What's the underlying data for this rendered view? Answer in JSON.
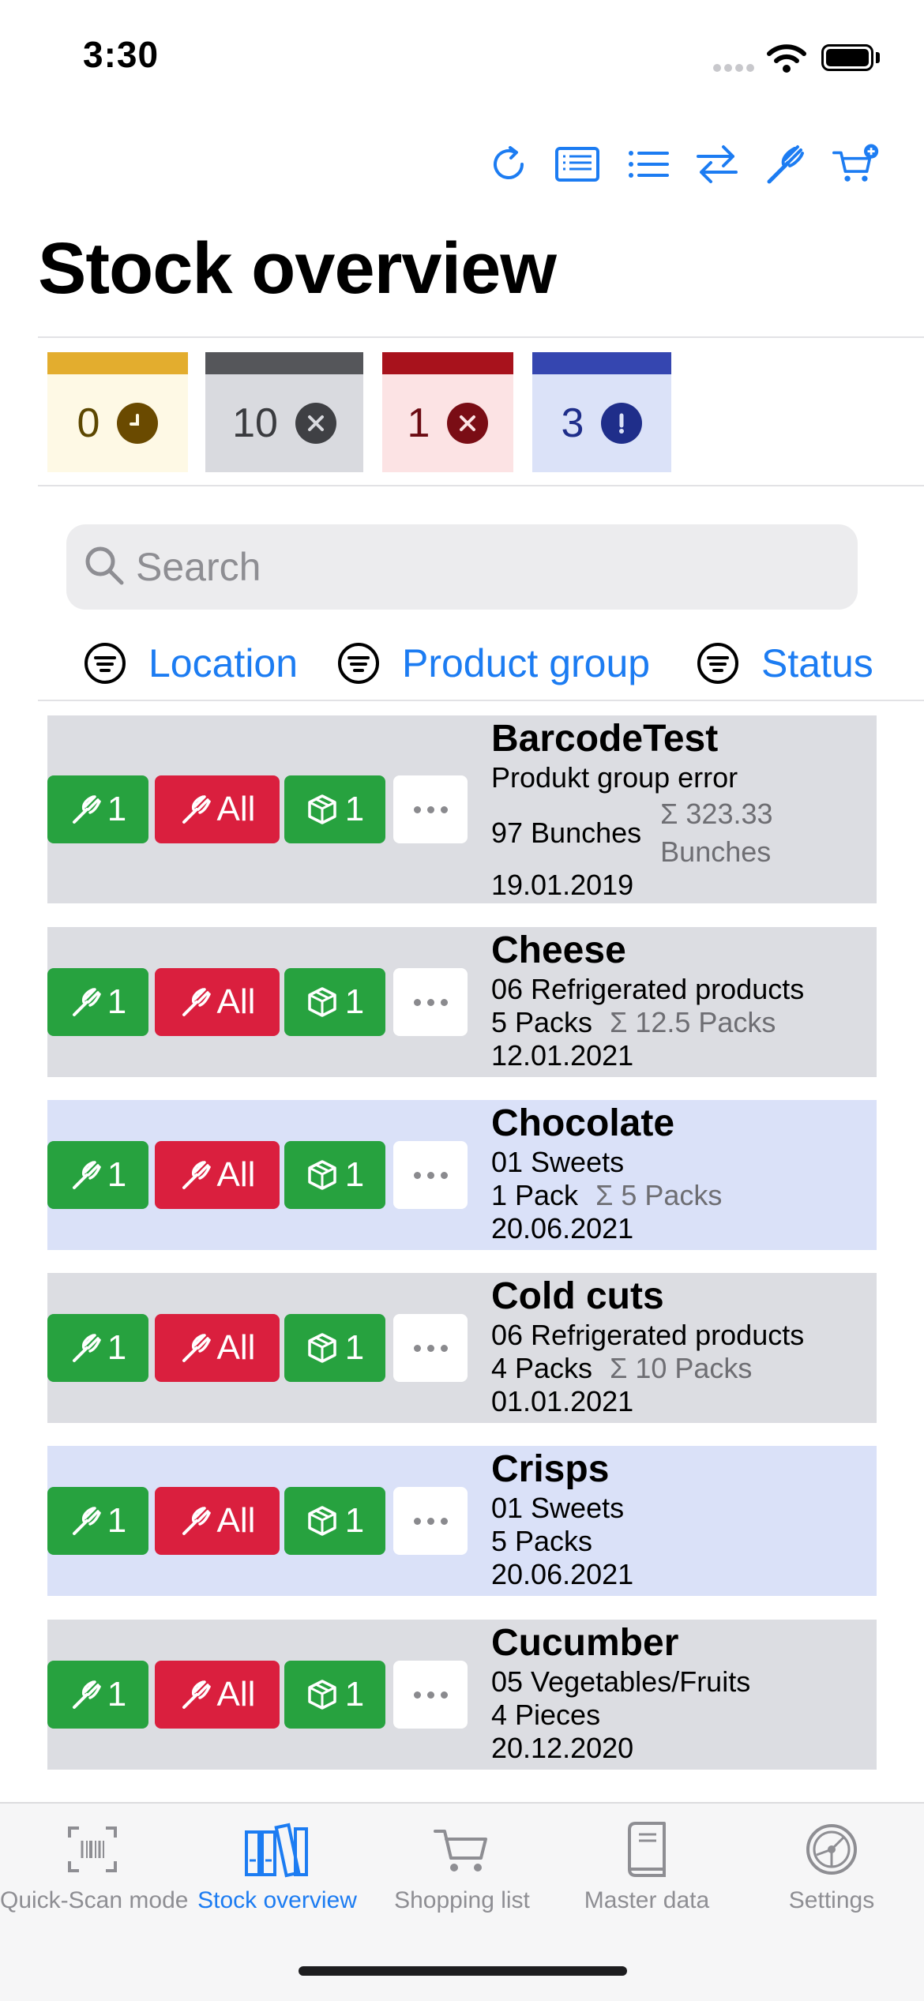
{
  "status_bar": {
    "time": "3:30"
  },
  "toolbar": {
    "icons": [
      "refresh-icon",
      "journal-icon",
      "list-icon",
      "transfer-icon",
      "consume-icon",
      "purchase-icon"
    ]
  },
  "page": {
    "title": "Stock overview"
  },
  "status_tiles": [
    {
      "count": "0",
      "kind": "due-soon",
      "bar": "#e3ad2e",
      "bg": "#fef9e5",
      "text": "#5c4700",
      "icon_bg": "#6a4a00"
    },
    {
      "count": "10",
      "kind": "overdue",
      "bar": "#55565a",
      "bg": "#d9dadf",
      "text": "#3a3b3f",
      "icon_bg": "#3f4044"
    },
    {
      "count": "1",
      "kind": "expired",
      "bar": "#a8121c",
      "bg": "#fce3e4",
      "text": "#6b0b12",
      "icon_bg": "#7a0d15"
    },
    {
      "count": "3",
      "kind": "below-min-stock",
      "bar": "#3546b0",
      "bg": "#dbe2f8",
      "text": "#1f2e8a",
      "icon_bg": "#1f2e8a"
    }
  ],
  "search": {
    "placeholder": "Search",
    "value": ""
  },
  "filters": {
    "location": "Location",
    "product_group": "Product group",
    "status": "Status"
  },
  "buttons": {
    "consume_one": "1",
    "consume_all": "All",
    "open_one": "1"
  },
  "rows": [
    {
      "name": "BarcodeTest",
      "group": "Produkt group error",
      "amount": "97 Bunches",
      "sum": "Σ 323.33",
      "sum_unit": "Bunches",
      "date": "19.01.2019",
      "bg": "#dcdde2"
    },
    {
      "name": "Cheese",
      "group": "06 Refrigerated products",
      "amount": "5 Packs",
      "sum": "Σ 12.5 Packs",
      "date": "12.01.2021",
      "bg": "#dcdde2"
    },
    {
      "name": "Chocolate",
      "group": "01 Sweets",
      "amount": "1 Pack",
      "sum": "Σ 5 Packs",
      "date": "20.06.2021",
      "bg": "#dae1f8"
    },
    {
      "name": "Cold cuts",
      "group": "06 Refrigerated products",
      "amount": "4 Packs",
      "sum": "Σ 10 Packs",
      "date": "01.01.2021",
      "bg": "#dcdde2"
    },
    {
      "name": "Crisps",
      "group": "01 Sweets",
      "amount": "5 Packs",
      "sum": "",
      "date": "20.06.2021",
      "bg": "#dae1f8"
    },
    {
      "name": "Cucumber",
      "group": "05 Vegetables/Fruits",
      "amount": "4 Pieces",
      "sum": "",
      "date": "20.12.2020",
      "bg": "#dcdde2"
    }
  ],
  "tabs": [
    {
      "label": "Quick-Scan mode",
      "icon": "barcode-scan-icon"
    },
    {
      "label": "Stock overview",
      "icon": "books-icon",
      "active": true
    },
    {
      "label": "Shopping list",
      "icon": "cart-icon"
    },
    {
      "label": "Master data",
      "icon": "book-icon"
    },
    {
      "label": "Settings",
      "icon": "gear-icon"
    }
  ],
  "colors": {
    "accent": "#1c7cf2",
    "consume_green": "#27a23f",
    "consume_all_red": "#da1f3e"
  }
}
